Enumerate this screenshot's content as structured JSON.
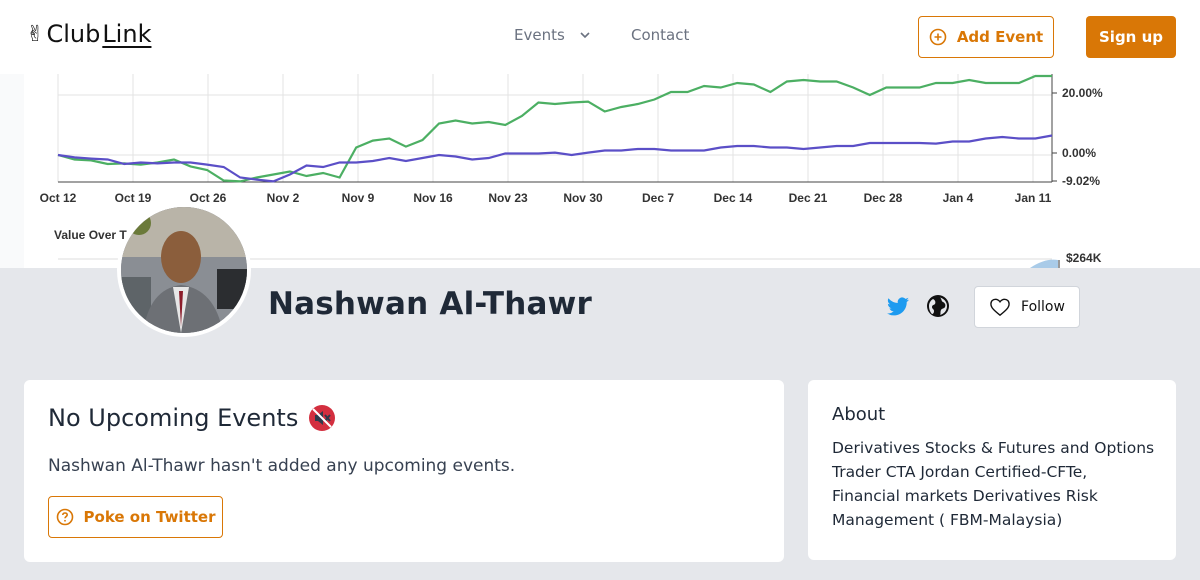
{
  "header": {
    "logo_text_a": "Club",
    "logo_text_b": "Link",
    "nav_events": "Events",
    "nav_contact": "Contact",
    "add_event_label": "Add Event",
    "sign_up_label": "Sign up",
    "accent_color": "#d97706"
  },
  "cover_chart": {
    "x_ticks": [
      "Oct 12",
      "Oct 19",
      "Oct 26",
      "Nov 2",
      "Nov 9",
      "Nov 16",
      "Nov 23",
      "Nov 30",
      "Dec 7",
      "Dec 14",
      "Dec 21",
      "Dec 28",
      "Jan 4",
      "Jan 11"
    ],
    "y_ticks": [
      "20.00%",
      "0.00%",
      "-9.02%"
    ],
    "lower_label": "Value Over T",
    "lower_y_tick": "$264K",
    "green_series": [
      0.0,
      -1.5,
      -1.8,
      -3.0,
      -2.8,
      -3.2,
      -2.5,
      -1.5,
      -3.8,
      -5.0,
      -8.5,
      -8.8,
      -7.5,
      -6.5,
      -5.5,
      -7.0,
      -6.0,
      -7.5,
      2.5,
      4.8,
      5.5,
      2.8,
      5.0,
      10.5,
      11.5,
      10.5,
      11.0,
      10.0,
      13.0,
      17.5,
      17.0,
      17.5,
      17.8,
      14.5,
      16.0,
      17.0,
      18.5,
      21.0,
      21.0,
      23.0,
      22.5,
      24.0,
      23.5,
      21.0,
      24.5,
      25.0,
      24.5,
      24.5,
      22.5,
      20.0,
      22.5,
      22.5,
      22.5,
      24.0,
      24.0,
      25.0,
      24.0,
      24.0,
      24.0,
      28.0,
      30.0
    ],
    "purple_series": [
      0.0,
      -0.8,
      -1.2,
      -1.5,
      -3.0,
      -2.5,
      -2.8,
      -2.5,
      -2.5,
      -3.2,
      -4.0,
      -7.5,
      -8.2,
      -8.8,
      -6.5,
      -3.5,
      -4.0,
      -2.5,
      -2.5,
      -2.0,
      -1.0,
      -2.0,
      -1.0,
      0.0,
      -0.5,
      -1.5,
      -1.0,
      0.5,
      0.5,
      0.5,
      0.8,
      0.0,
      0.8,
      1.5,
      1.5,
      2.0,
      2.0,
      1.5,
      1.5,
      1.5,
      2.5,
      3.0,
      3.0,
      2.5,
      2.5,
      2.0,
      2.5,
      3.0,
      3.0,
      4.0,
      4.0,
      4.0,
      4.0,
      3.8,
      4.5,
      4.5,
      5.5,
      6.0,
      5.5,
      5.5,
      6.5
    ]
  },
  "profile": {
    "name": "Nashwan Al-Thawr",
    "follow_label": "Follow"
  },
  "events_card": {
    "title": "No Upcoming Events",
    "subtitle": "Nashwan Al-Thawr hasn't added any upcoming events.",
    "poke_label": "Poke on Twitter"
  },
  "about_card": {
    "title": "About",
    "body": "Derivatives Stocks & Futures and Options Trader CTA Jordan Certified-CFTe, Financial markets Derivatives Risk Management ( FBM-Malaysia)"
  }
}
